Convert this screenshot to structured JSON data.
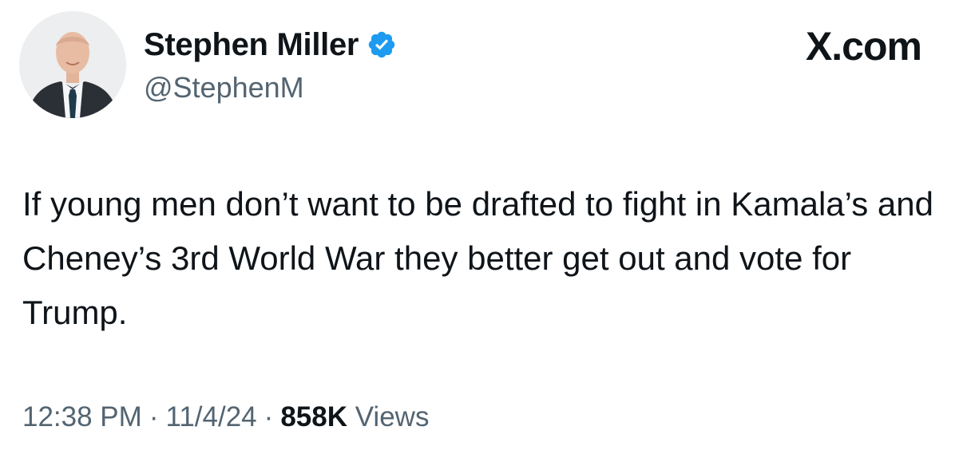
{
  "author": {
    "display_name": "Stephen Miller",
    "handle": "@StephenM",
    "verified": true,
    "verified_color": "#1d9bf0",
    "avatar_icon": "profile-photo"
  },
  "brand": {
    "label": "X.com"
  },
  "tweet": {
    "text": "If young men don’t want to be drafted to fight in Kamala’s and Cheney’s 3rd World War they better get out and vote for Trump."
  },
  "meta": {
    "time": "12:38 PM",
    "separator": "·",
    "date": "11/4/24",
    "views_count": "858K",
    "views_label": "Views"
  },
  "colors": {
    "text": "#0f1419",
    "secondary": "#536471"
  }
}
